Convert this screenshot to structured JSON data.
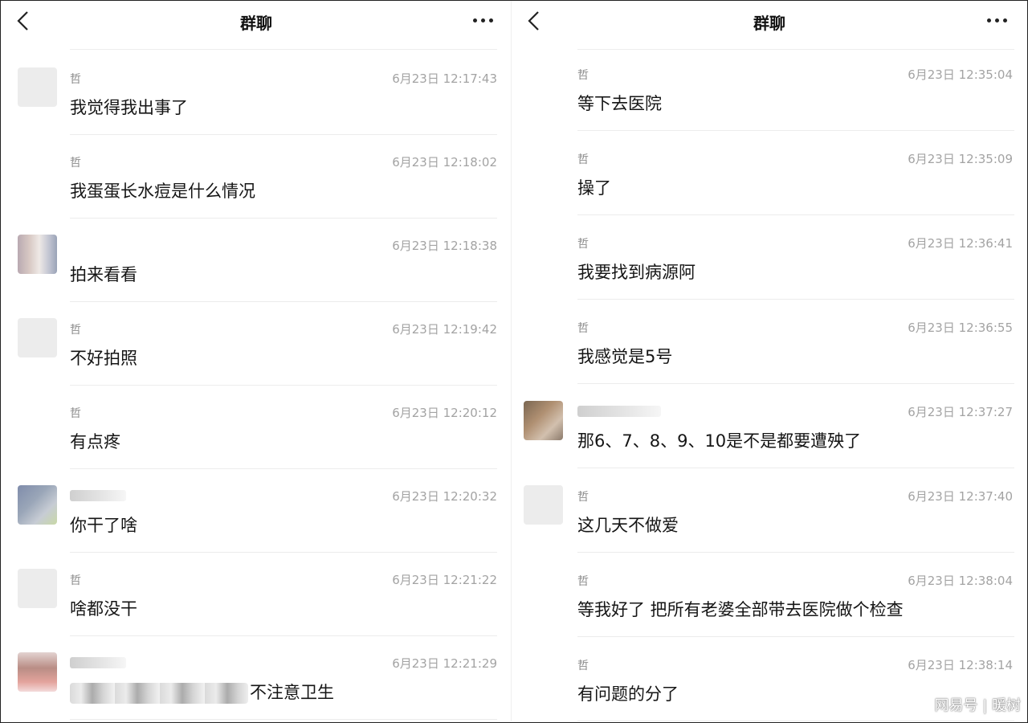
{
  "left": {
    "title": "群聊",
    "messages": [
      {
        "sender": "哲",
        "time": "6月23日 12:17:43",
        "text": "我觉得我出事了",
        "avatar": "plain"
      },
      {
        "sender": "哲",
        "time": "6月23日 12:18:02",
        "text": "我蛋蛋长水痘是什么情况",
        "avatar": "none"
      },
      {
        "sender": "",
        "time": "6月23日 12:18:38",
        "text": "拍来看看",
        "avatar": "blur-a"
      },
      {
        "sender": "哲",
        "time": "6月23日 12:19:42",
        "text": "不好拍照",
        "avatar": "plain"
      },
      {
        "sender": "哲",
        "time": "6月23日 12:20:12",
        "text": "有点疼",
        "avatar": "none"
      },
      {
        "sender": "",
        "time": "6月23日 12:20:32",
        "text": "你干了啥",
        "avatar": "blur-b"
      },
      {
        "sender": "哲",
        "time": "6月23日 12:21:22",
        "text": "啥都没干",
        "avatar": "plain"
      },
      {
        "sender": "",
        "time": "6月23日 12:21:29",
        "text": "不注意卫生",
        "avatar": "blur-c"
      }
    ]
  },
  "right": {
    "title": "群聊",
    "messages": [
      {
        "sender": "哲",
        "time": "6月23日 12:35:04",
        "text": "等下去医院",
        "avatar": "none"
      },
      {
        "sender": "哲",
        "time": "6月23日 12:35:09",
        "text": "操了",
        "avatar": "none"
      },
      {
        "sender": "哲",
        "time": "6月23日 12:36:41",
        "text": "我要找到病源阿",
        "avatar": "none"
      },
      {
        "sender": "哲",
        "time": "6月23日 12:36:55",
        "text": "我感觉是5号",
        "avatar": "none"
      },
      {
        "sender": "",
        "time": "6月23日 12:37:27",
        "text": "那6、7、8、9、10是不是都要遭殃了",
        "avatar": "blur-d"
      },
      {
        "sender": "哲",
        "time": "6月23日 12:37:40",
        "text": "这几天不做爱",
        "avatar": "plain"
      },
      {
        "sender": "哲",
        "time": "6月23日 12:38:04",
        "text": "等我好了 把所有老婆全部带去医院做个检查",
        "avatar": "none"
      },
      {
        "sender": "哲",
        "time": "6月23日 12:38:14",
        "text": "有问题的分了",
        "avatar": "none"
      }
    ]
  },
  "watermark": "网易号 | 暖树",
  "icons": {
    "back": "chevron-left-icon",
    "more": "more-dots-icon"
  }
}
